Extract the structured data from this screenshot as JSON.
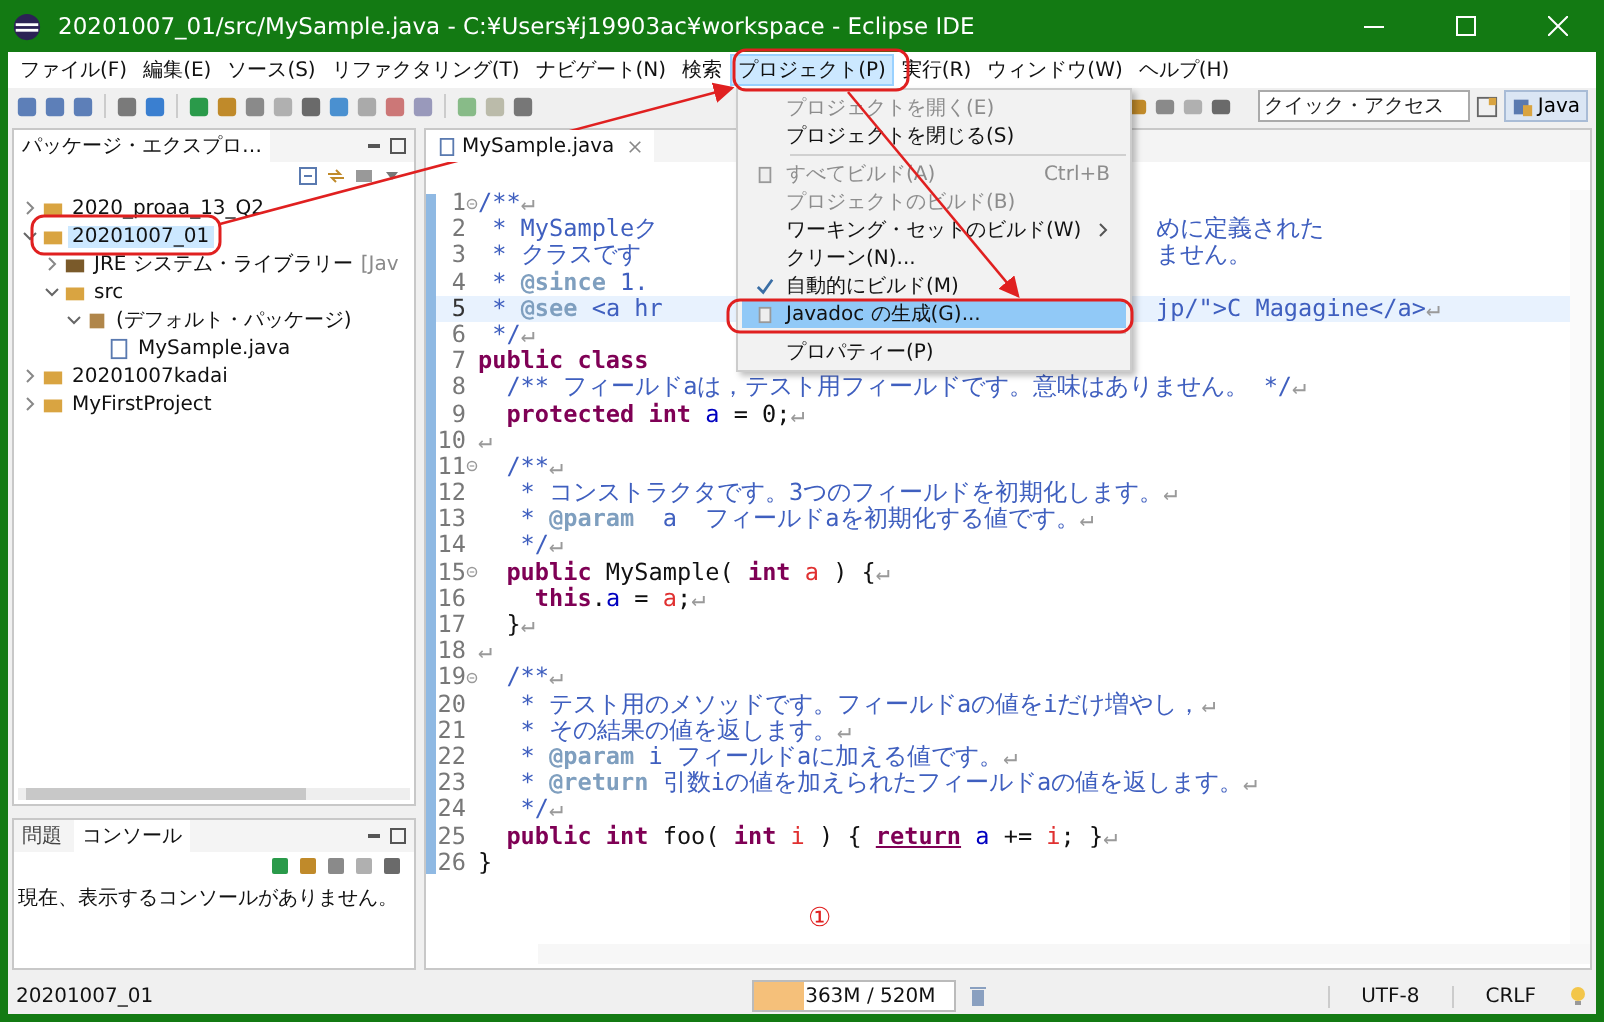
{
  "window": {
    "title": "20201007_01/src/MySample.java - C:¥Users¥j19903ac¥workspace - Eclipse IDE"
  },
  "menubar": [
    {
      "label": "ファイル(F)",
      "selected": false
    },
    {
      "label": "編集(E)",
      "selected": false
    },
    {
      "label": "ソース(S)",
      "selected": false
    },
    {
      "label": "リファクタリング(T)",
      "selected": false
    },
    {
      "label": "ナビゲート(N)",
      "selected": false
    },
    {
      "label": "検索",
      "selected": false
    },
    {
      "label": "プロジェクト(P)",
      "selected": true
    },
    {
      "label": "実行(R)",
      "selected": false
    },
    {
      "label": "ウィンドウ(W)",
      "selected": false
    },
    {
      "label": "ヘルプ(H)",
      "selected": false
    }
  ],
  "toolbar": {
    "quick_access": {
      "placeholder": "クイック・アクセス"
    },
    "perspective": {
      "label": "Java",
      "selected": true
    }
  },
  "project_menu": [
    {
      "kind": "item",
      "label": "プロジェクトを開く(E)",
      "disabled": true,
      "checked": false,
      "selected": false,
      "submenu": false
    },
    {
      "kind": "item",
      "label": "プロジェクトを閉じる(S)",
      "disabled": false,
      "checked": false,
      "selected": false,
      "submenu": false
    },
    {
      "kind": "separator"
    },
    {
      "kind": "item",
      "label": "すべてビルド(A)",
      "shortcut": "Ctrl+B",
      "disabled": true,
      "checked": false,
      "selected": false,
      "submenu": false,
      "icon": true
    },
    {
      "kind": "item",
      "label": "プロジェクトのビルド(B)",
      "disabled": true,
      "checked": false,
      "selected": false,
      "submenu": false
    },
    {
      "kind": "item",
      "label": "ワーキング・セットのビルド(W)",
      "disabled": false,
      "checked": false,
      "selected": false,
      "submenu": true
    },
    {
      "kind": "item",
      "label": "クリーン(N)...",
      "disabled": false,
      "checked": false,
      "selected": false,
      "submenu": false
    },
    {
      "kind": "item",
      "label": "自動的にビルド(M)",
      "disabled": false,
      "checked": true,
      "selected": false,
      "submenu": false
    },
    {
      "kind": "item",
      "label": "Javadoc の生成(G)...",
      "disabled": false,
      "checked": false,
      "selected": true,
      "submenu": false,
      "icon": true
    },
    {
      "kind": "separator"
    },
    {
      "kind": "item",
      "label": "プロパティー(P)",
      "disabled": false,
      "checked": false,
      "selected": false,
      "submenu": false
    }
  ],
  "explorer": {
    "title": "パッケージ・エクスプロ…",
    "tree": [
      {
        "kind": "project",
        "label": "2020_proaa_13_Q2",
        "expanded": false,
        "selected": false
      },
      {
        "kind": "project",
        "label": "20201007_01",
        "expanded": true,
        "selected": true,
        "children": [
          {
            "kind": "library",
            "label": "JRE システム・ライブラリー",
            "detail": "[Jav",
            "expanded": false,
            "selected": false
          },
          {
            "kind": "folder",
            "label": "src",
            "expanded": true,
            "selected": false,
            "children": [
              {
                "kind": "package",
                "label": "(デフォルト・パッケージ)",
                "expanded": true,
                "selected": false,
                "children": [
                  {
                    "kind": "file",
                    "label": "MySample.java",
                    "selected": false
                  }
                ]
              }
            ]
          }
        ]
      },
      {
        "kind": "project",
        "label": "20201007kadai",
        "expanded": false,
        "selected": false
      },
      {
        "kind": "project",
        "label": "MyFirstProject",
        "expanded": false,
        "selected": false
      }
    ]
  },
  "console": {
    "tabs": [
      {
        "label": "問題",
        "selected": false
      },
      {
        "label": "コンソール",
        "selected": true
      }
    ],
    "message": "現在、表示するコンソールがありません。"
  },
  "editor": {
    "tab": "MySample.java",
    "lines": [
      {
        "n": "1",
        "fold": true,
        "current": false,
        "tokens": [
          {
            "kind": "c",
            "text": "/**"
          },
          {
            "kind": "eol",
            "text": "↵"
          }
        ]
      },
      {
        "n": "2",
        "current": false,
        "tokens": [
          {
            "kind": "c",
            "text": " * MySampleク"
          }
        ],
        "right": [
          {
            "kind": "c",
            "text": "めに定義された"
          }
        ]
      },
      {
        "n": "3",
        "current": false,
        "tokens": [
          {
            "kind": "c",
            "text": " * クラスです"
          }
        ],
        "right": [
          {
            "kind": "c",
            "text": "ません。"
          }
        ]
      },
      {
        "n": "4",
        "current": false,
        "tokens": [
          {
            "kind": "c",
            "text": " * "
          },
          {
            "kind": "tag",
            "text": "@since"
          },
          {
            "kind": "c",
            "text": " 1."
          }
        ]
      },
      {
        "n": "5",
        "current": true,
        "tokens": [
          {
            "kind": "c",
            "text": " * "
          },
          {
            "kind": "tag",
            "text": "@see"
          },
          {
            "kind": "c",
            "text": " <a hr"
          }
        ],
        "right": [
          {
            "kind": "c",
            "text": "jp/\">C Magagine</a>"
          },
          {
            "kind": "eol",
            "text": "↵"
          }
        ]
      },
      {
        "n": "6",
        "current": false,
        "tokens": [
          {
            "kind": "c",
            "text": " */"
          },
          {
            "kind": "eol",
            "text": "↵"
          }
        ]
      },
      {
        "n": "7",
        "current": false,
        "tokens": [
          {
            "kind": "kw",
            "text": "public class"
          }
        ]
      },
      {
        "n": "8",
        "current": false,
        "tokens": [
          {
            "kind": "c",
            "text": "  /** フィールドaは，テスト用フィールドです。意味はありません。 */"
          },
          {
            "kind": "eol",
            "text": "↵"
          }
        ]
      },
      {
        "n": "9",
        "current": false,
        "tokens": [
          {
            "kind": "kw",
            "text": "  protected int "
          },
          {
            "kind": "fld",
            "text": "a"
          },
          {
            "kind": "p",
            "text": " = 0;"
          },
          {
            "kind": "eol",
            "text": "↵"
          }
        ]
      },
      {
        "n": "10",
        "current": false,
        "tokens": [
          {
            "kind": "eol",
            "text": "↵"
          }
        ]
      },
      {
        "n": "11",
        "fold": true,
        "current": false,
        "tokens": [
          {
            "kind": "c",
            "text": "  /**"
          },
          {
            "kind": "eol",
            "text": "↵"
          }
        ]
      },
      {
        "n": "12",
        "current": false,
        "tokens": [
          {
            "kind": "c",
            "text": "   * コンストラクタです。3つのフィールドを初期化します。"
          },
          {
            "kind": "eol",
            "text": "↵"
          }
        ]
      },
      {
        "n": "13",
        "current": false,
        "tokens": [
          {
            "kind": "c",
            "text": "   * "
          },
          {
            "kind": "tag",
            "text": "@param"
          },
          {
            "kind": "c",
            "text": "  a  フィールドaを初期化する値です。"
          },
          {
            "kind": "eol",
            "text": "↵"
          }
        ]
      },
      {
        "n": "14",
        "current": false,
        "tokens": [
          {
            "kind": "c",
            "text": "   */"
          },
          {
            "kind": "eol",
            "text": "↵"
          }
        ]
      },
      {
        "n": "15",
        "fold": true,
        "current": false,
        "tokens": [
          {
            "kind": "kw",
            "text": "  public"
          },
          {
            "kind": "p",
            "text": " MySample( "
          },
          {
            "kind": "kw",
            "text": "int "
          },
          {
            "kind": "var",
            "text": "a"
          },
          {
            "kind": "p",
            "text": " ) {"
          },
          {
            "kind": "eol",
            "text": "↵"
          }
        ]
      },
      {
        "n": "16",
        "current": false,
        "tokens": [
          {
            "kind": "kw",
            "text": "    this"
          },
          {
            "kind": "p",
            "text": "."
          },
          {
            "kind": "fld",
            "text": "a"
          },
          {
            "kind": "p",
            "text": " = "
          },
          {
            "kind": "var",
            "text": "a"
          },
          {
            "kind": "p",
            "text": ";"
          },
          {
            "kind": "eol",
            "text": "↵"
          }
        ]
      },
      {
        "n": "17",
        "current": false,
        "tokens": [
          {
            "kind": "p",
            "text": "  }"
          },
          {
            "kind": "eol",
            "text": "↵"
          }
        ]
      },
      {
        "n": "18",
        "current": false,
        "tokens": [
          {
            "kind": "eol",
            "text": "↵"
          }
        ]
      },
      {
        "n": "19",
        "fold": true,
        "current": false,
        "tokens": [
          {
            "kind": "c",
            "text": "  /**"
          },
          {
            "kind": "eol",
            "text": "↵"
          }
        ]
      },
      {
        "n": "20",
        "current": false,
        "tokens": [
          {
            "kind": "c",
            "text": "   * テスト用のメソッドです。フィールドaの値をiだけ増やし，"
          },
          {
            "kind": "eol",
            "text": "↵"
          }
        ]
      },
      {
        "n": "21",
        "current": false,
        "tokens": [
          {
            "kind": "c",
            "text": "   * その結果の値を返します。"
          },
          {
            "kind": "eol",
            "text": "↵"
          }
        ]
      },
      {
        "n": "22",
        "current": false,
        "tokens": [
          {
            "kind": "c",
            "text": "   * "
          },
          {
            "kind": "tag",
            "text": "@param"
          },
          {
            "kind": "c",
            "text": " i フィールドaに加える値です。"
          },
          {
            "kind": "eol",
            "text": "↵"
          }
        ]
      },
      {
        "n": "23",
        "current": false,
        "tokens": [
          {
            "kind": "c",
            "text": "   * "
          },
          {
            "kind": "tag",
            "text": "@return"
          },
          {
            "kind": "c",
            "text": " 引数iの値を加えられたフィールドaの値を返します。"
          },
          {
            "kind": "eol",
            "text": "↵"
          }
        ]
      },
      {
        "n": "24",
        "current": false,
        "tokens": [
          {
            "kind": "c",
            "text": "   */"
          },
          {
            "kind": "eol",
            "text": "↵"
          }
        ]
      },
      {
        "n": "25",
        "current": false,
        "tokens": [
          {
            "kind": "kw",
            "text": "  public int"
          },
          {
            "kind": "p",
            "text": " foo( "
          },
          {
            "kind": "kw",
            "text": "int "
          },
          {
            "kind": "var",
            "text": "i"
          },
          {
            "kind": "p",
            "text": " ) { "
          },
          {
            "kind": "kwmark",
            "text": "return"
          },
          {
            "kind": "fld",
            "text": " a"
          },
          {
            "kind": "p",
            "text": " += "
          },
          {
            "kind": "var",
            "text": "i"
          },
          {
            "kind": "p",
            "text": "; }"
          },
          {
            "kind": "eol",
            "text": "↵"
          }
        ]
      },
      {
        "n": "26",
        "current": false,
        "tokens": [
          {
            "kind": "p",
            "text": "}"
          }
        ]
      }
    ]
  },
  "annotation": {
    "label": "①"
  },
  "status_bar": {
    "selection": "20201007_01",
    "memory": {
      "label": "363M / 520M",
      "level": 0.25
    },
    "encoding": "UTF-8",
    "line_delimiter": "CRLF"
  }
}
